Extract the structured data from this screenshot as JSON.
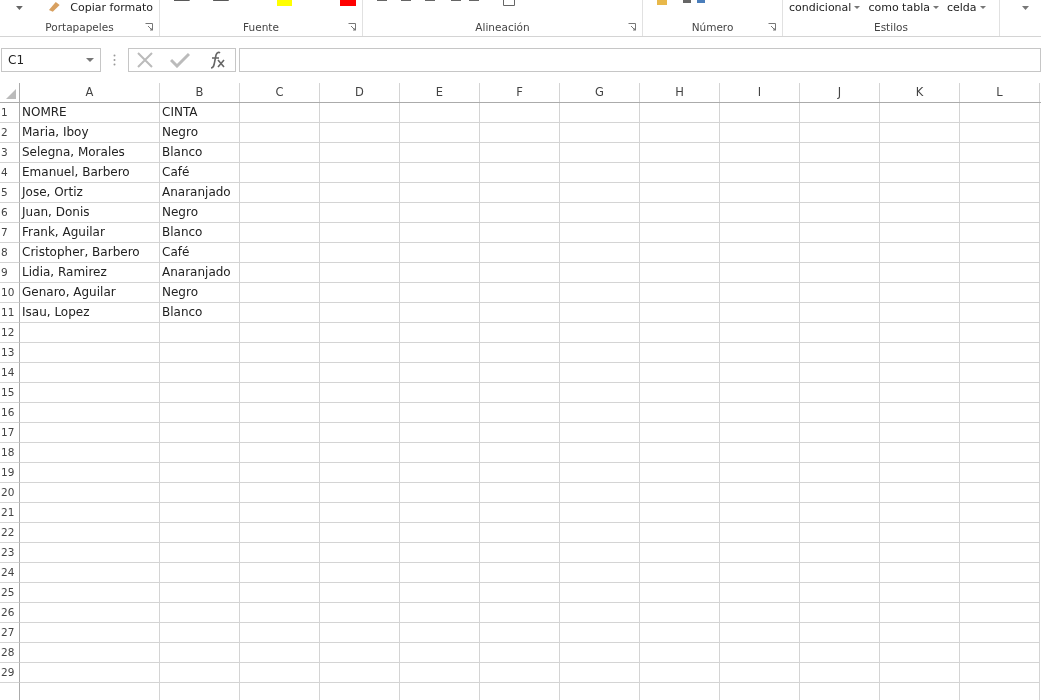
{
  "ribbon": {
    "groups": [
      {
        "label": "Portapapeles",
        "kind": "clipboard",
        "items": [
          "Copiar formato"
        ]
      },
      {
        "label": "Fuente",
        "kind": "font"
      },
      {
        "label": "Alineación",
        "kind": "align"
      },
      {
        "label": "Número",
        "kind": "number"
      },
      {
        "label": "Estilos",
        "kind": "styles",
        "items": [
          "condicional",
          "como tabla",
          "celda"
        ]
      }
    ]
  },
  "name_box": {
    "value": "C1"
  },
  "sheet": {
    "columns": [
      "A",
      "B",
      "C",
      "D",
      "E",
      "F",
      "G",
      "H",
      "I",
      "J",
      "K",
      "L"
    ],
    "rows": [
      {
        "number": "1",
        "cells": [
          "NOMRE",
          "CINTA"
        ]
      },
      {
        "number": "2",
        "cells": [
          "Maria, Iboy",
          "Negro"
        ]
      },
      {
        "number": "3",
        "cells": [
          "Selegna, Morales",
          "Blanco"
        ]
      },
      {
        "number": "4",
        "cells": [
          "Emanuel, Barbero",
          "Café"
        ]
      },
      {
        "number": "5",
        "cells": [
          "Jose, Ortiz",
          "Anaranjado"
        ]
      },
      {
        "number": "6",
        "cells": [
          "Juan, Donis",
          "Negro"
        ]
      },
      {
        "number": "7",
        "cells": [
          "Frank, Aguilar",
          "Blanco"
        ]
      },
      {
        "number": "8",
        "cells": [
          "Cristopher, Barbero",
          "Café"
        ]
      },
      {
        "number": "9",
        "cells": [
          "Lidia, Ramirez",
          "Anaranjado"
        ]
      },
      {
        "number": "10",
        "cells": [
          "Genaro, Aguilar",
          "Negro"
        ]
      },
      {
        "number": "11",
        "cells": [
          "Isau, Lopez",
          "Blanco"
        ]
      },
      {
        "number": "12"
      },
      {
        "number": "13"
      },
      {
        "number": "14"
      },
      {
        "number": "15"
      },
      {
        "number": "16"
      },
      {
        "number": "17"
      },
      {
        "number": "18"
      },
      {
        "number": "19"
      },
      {
        "number": "20"
      },
      {
        "number": "21"
      },
      {
        "number": "22"
      },
      {
        "number": "23"
      },
      {
        "number": "24"
      },
      {
        "number": "25"
      },
      {
        "number": "26"
      },
      {
        "number": "27"
      },
      {
        "number": "28"
      },
      {
        "number": "29"
      }
    ]
  }
}
